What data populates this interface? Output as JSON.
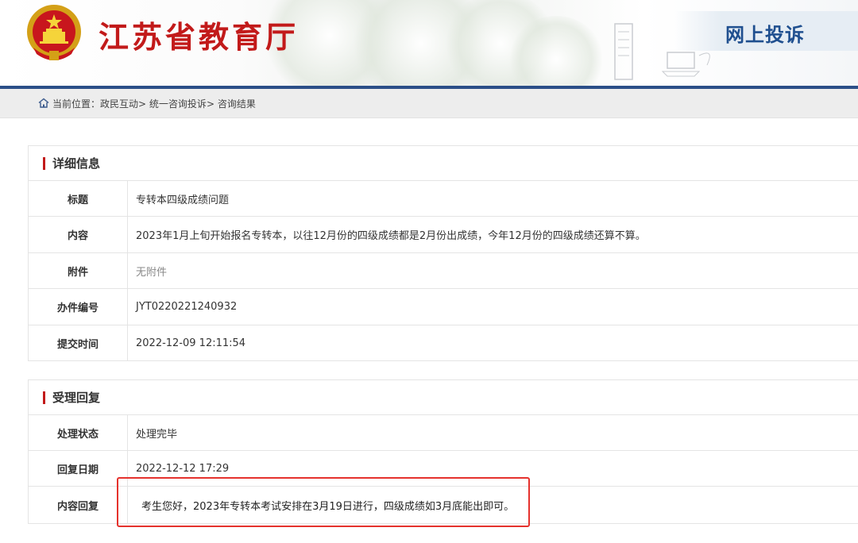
{
  "header": {
    "site_title": "江苏省教育厅",
    "online_label": "网上投诉",
    "emblem_icon": "national-emblem-icon",
    "accent_color": "#c21a1a",
    "bar_color": "#2b4f88"
  },
  "breadcrumb": {
    "icon": "home-icon",
    "prefix": "当前位置：",
    "items": [
      "政民互动",
      "统一咨询投诉",
      "咨询结果"
    ],
    "separator": ">"
  },
  "details": {
    "title": "详细信息",
    "rows": [
      {
        "label": "标题",
        "value": "专转本四级成绩问题"
      },
      {
        "label": "内容",
        "value": "2023年1月上旬开始报名专转本，以往12月份的四级成绩都是2月份出成绩，今年12月份的四级成绩还算不算。"
      },
      {
        "label": "附件",
        "value": "无附件"
      },
      {
        "label": "办件编号",
        "value": "JYT0220221240932"
      },
      {
        "label": "提交时间",
        "value": "2022-12-09 12:11:54"
      }
    ]
  },
  "reply": {
    "title": "受理回复",
    "rows": [
      {
        "label": "处理状态",
        "value": "处理完毕"
      },
      {
        "label": "回复日期",
        "value": "2022-12-12 17:29"
      },
      {
        "label": "内容回复",
        "value": "考生您好，2023年专转本考试安排在3月19日进行，四级成绩如3月底能出即可。"
      }
    ],
    "highlight_color": "#e5322d"
  }
}
